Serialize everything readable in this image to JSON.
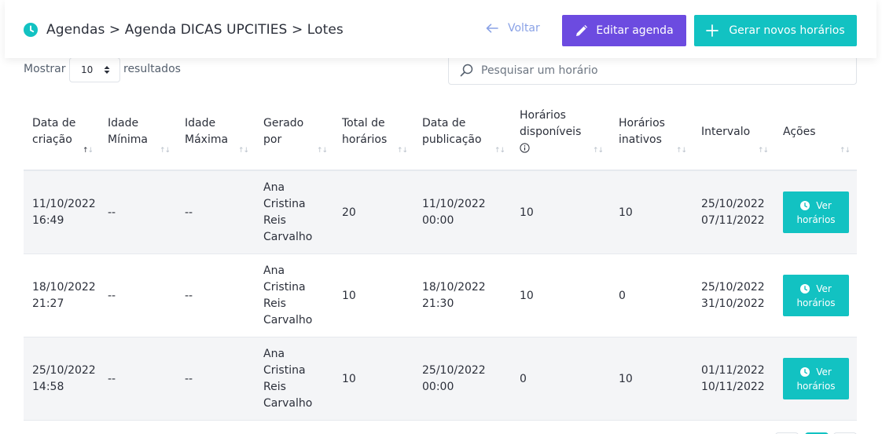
{
  "header": {
    "breadcrumb": "Agendas > Agenda DICAS UPCITIES > Lotes",
    "back_label": "Voltar",
    "edit_label": "Editar agenda",
    "generate_label": "Gerar novos horários"
  },
  "controls": {
    "show_label": "Mostrar",
    "page_size": "10",
    "results_label": "resultados",
    "search_placeholder": "Pesquisar um horário",
    "search_value": ""
  },
  "table": {
    "columns": [
      {
        "label": "Data de criação",
        "sorted": "asc"
      },
      {
        "label": "Idade Mínima"
      },
      {
        "label": "Idade Máxima"
      },
      {
        "label": "Gerado por"
      },
      {
        "label": "Total de horários"
      },
      {
        "label": "Data de publicação"
      },
      {
        "label": "Horários disponíveis",
        "info": true
      },
      {
        "label": "Horários inativos"
      },
      {
        "label": "Intervalo"
      },
      {
        "label": "Ações"
      }
    ],
    "rows": [
      {
        "created": "11/10/2022 16:49",
        "min_age": "--",
        "max_age": "--",
        "generated_by": "Ana Cristina Reis Carvalho",
        "total": "20",
        "published": "11/10/2022 00:00",
        "available": "10",
        "inactive": "10",
        "interval_start": "25/10/2022",
        "interval_end": "07/11/2022",
        "action_line1": "Ver",
        "action_line2": "horários"
      },
      {
        "created": "18/10/2022 21:27",
        "min_age": "--",
        "max_age": "--",
        "generated_by": "Ana Cristina Reis Carvalho",
        "total": "10",
        "published": "18/10/2022 21:30",
        "available": "10",
        "inactive": "0",
        "interval_start": "25/10/2022",
        "interval_end": "31/10/2022",
        "action_line1": "Ver",
        "action_line2": "horários"
      },
      {
        "created": "25/10/2022 14:58",
        "min_age": "--",
        "max_age": "--",
        "generated_by": "Ana Cristina Reis Carvalho",
        "total": "10",
        "published": "25/10/2022 00:00",
        "available": "0",
        "inactive": "10",
        "interval_start": "01/11/2022",
        "interval_end": "10/11/2022",
        "action_line1": "Ver",
        "action_line2": "horários"
      }
    ]
  },
  "icons": {
    "breadcrumb": "clock-icon",
    "back": "arrow-left-icon",
    "edit": "pencil-icon",
    "generate": "plus-icon",
    "search": "search-icon",
    "select": "sort-caret-icon",
    "info": "info-icon",
    "action": "clock-icon"
  },
  "colors": {
    "primary_teal": "#12c2c2",
    "edit_purple": "#6c4be0",
    "back_link": "#8aa2e6",
    "row_stripe": "#f4f5f7"
  }
}
